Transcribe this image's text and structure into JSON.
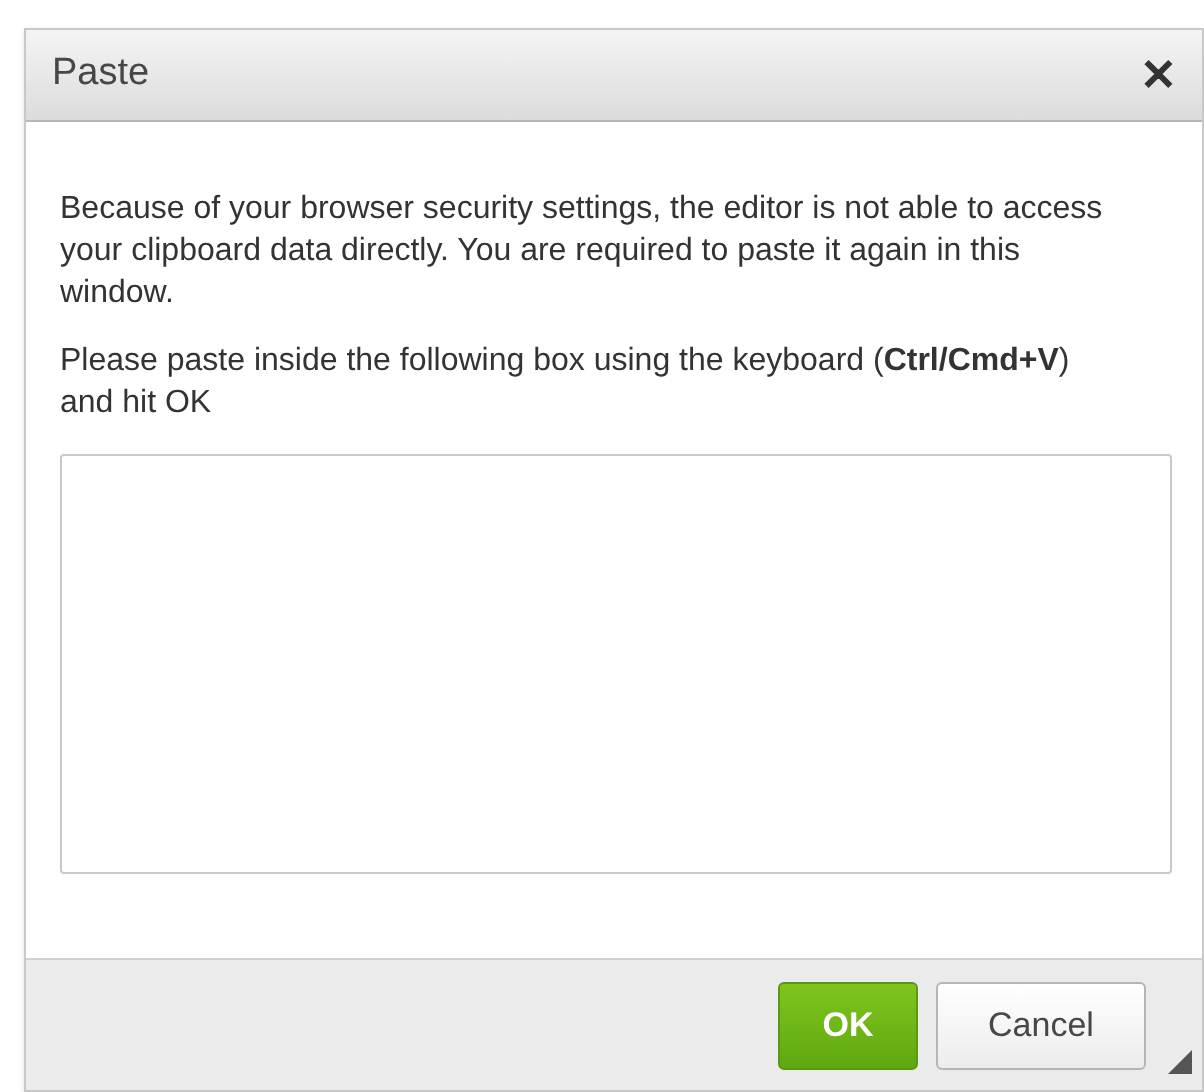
{
  "dialog": {
    "title": "Paste",
    "close": "✕",
    "message": "Because of your browser security settings, the editor is not able to access your clipboard data directly. You are required to paste it again in this window.",
    "instruction": "Please paste inside the following box using the keyboard (**Ctrl/Cmd+V**) and hit OK",
    "buttons": [
      {
        "label": "OK",
        "kind": "primary"
      },
      {
        "label": "Cancel",
        "kind": "secondary"
      }
    ]
  }
}
